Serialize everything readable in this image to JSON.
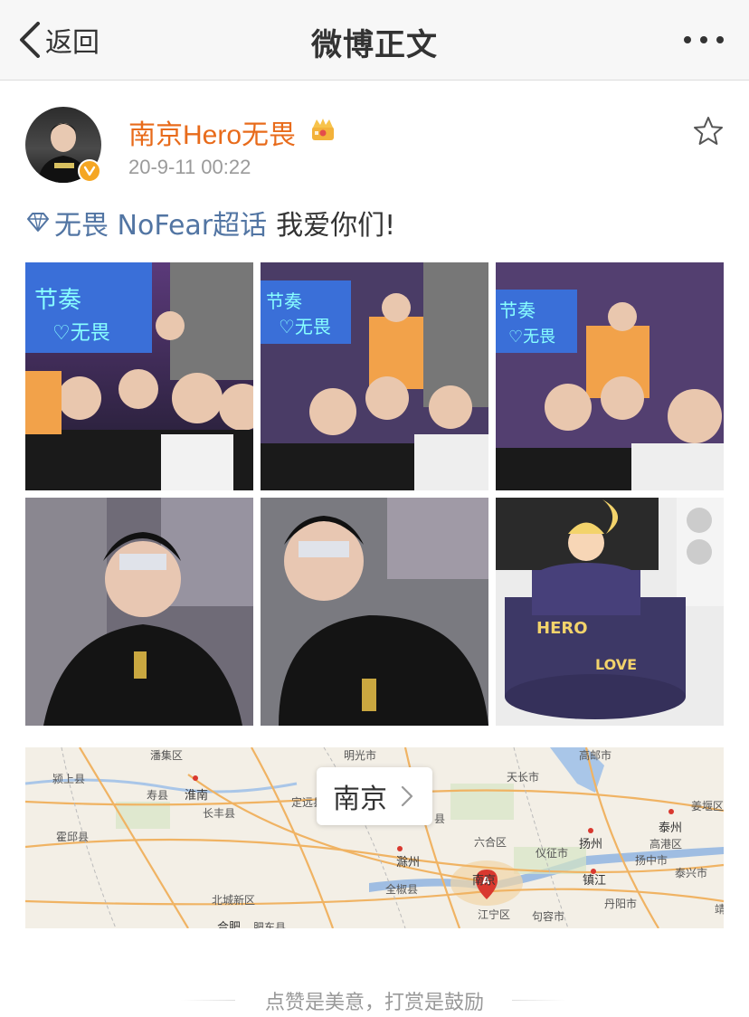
{
  "nav": {
    "back_label": "返回",
    "title": "微博正文",
    "back_icon": "chevron-left-icon",
    "more_icon": "more-dots-icon"
  },
  "post": {
    "username": "南京Hero无畏",
    "timestamp": "20-9-11 00:22",
    "topic": "无畏 NoFear超话",
    "text": "我爱你们!",
    "photo_count": 6,
    "star_icon": "favorite-star-icon"
  },
  "map": {
    "location_name": "南京",
    "place_labels": [
      "潘集区",
      "明光市",
      "高邮市",
      "颍上县",
      "寿县",
      "淮南",
      "天长市",
      "定远县",
      "长丰县",
      "霍邱县",
      "六合区",
      "仪征市",
      "扬州",
      "滁州",
      "全椒县",
      "南京",
      "镇江",
      "丹阳市",
      "句容市",
      "江宁区",
      "北城新区",
      "合肥",
      "肥东县",
      "泰州",
      "姜堰区",
      "高港区",
      "扬中市",
      "泰兴市",
      "靖",
      "县"
    ]
  },
  "footer": {
    "reward_text": "点赞是美意，打赏是鼓励"
  },
  "colors": {
    "username": "#e86b1b",
    "topic": "#5275a3",
    "time": "#9a9a9a",
    "navbar_bg": "#f7f7f7"
  }
}
